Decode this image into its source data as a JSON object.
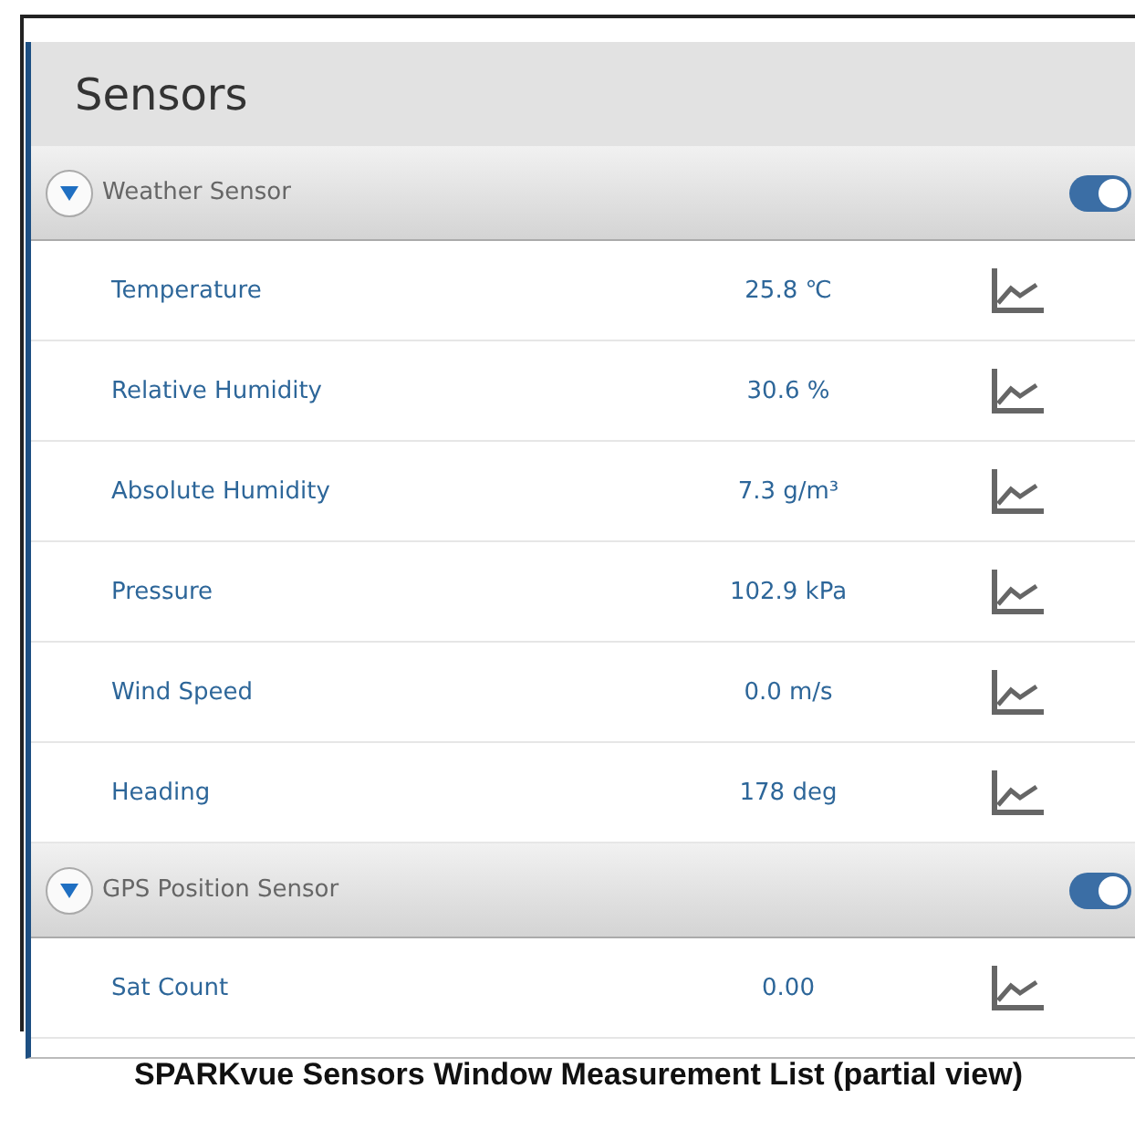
{
  "window": {
    "title": "Sensors"
  },
  "groups": [
    {
      "name": "Weather Sensor",
      "expanded": true,
      "on": true,
      "measurements": [
        {
          "name": "Temperature",
          "value": "25.8 ℃"
        },
        {
          "name": "Relative Humidity",
          "value": "30.6 %"
        },
        {
          "name": "Absolute Humidity",
          "value": "7.3 g/m³"
        },
        {
          "name": "Pressure",
          "value": "102.9 kPa"
        },
        {
          "name": "Wind Speed",
          "value": "0.0 m/s"
        },
        {
          "name": "Heading",
          "value": "178 deg"
        }
      ]
    },
    {
      "name": "GPS Position Sensor",
      "expanded": true,
      "on": true,
      "measurements": [
        {
          "name": "Sat Count",
          "value": "0.00"
        }
      ]
    }
  ],
  "caption": "SPARKvue Sensors Window Measurement List (partial view)"
}
